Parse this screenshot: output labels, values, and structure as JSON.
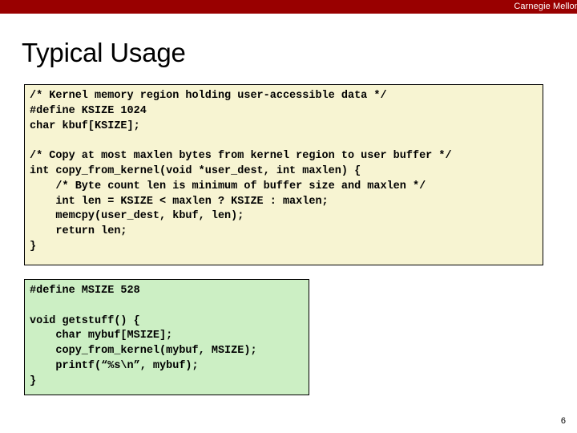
{
  "header": {
    "brand": "Carnegie Mellon",
    "bar_color": "#990000",
    "text_color": "#ffffff"
  },
  "slide": {
    "title": "Typical Usage",
    "page_number": "6"
  },
  "code_blocks": [
    {
      "name": "kernel-code",
      "background_color": "#F7F4D2",
      "border_color": "#000000",
      "lines": [
        "/* Kernel memory region holding user-accessible data */",
        "#define KSIZE 1024",
        "char kbuf[KSIZE];",
        "",
        "/* Copy at most maxlen bytes from kernel region to user buffer */",
        "int copy_from_kernel(void *user_dest, int maxlen) {",
        "    /* Byte count len is minimum of buffer size and maxlen */",
        "    int len = KSIZE < maxlen ? KSIZE : maxlen;",
        "    memcpy(user_dest, kbuf, len);",
        "    return len;",
        "}"
      ]
    },
    {
      "name": "user-code",
      "background_color": "#CCEFC4",
      "border_color": "#000000",
      "lines": [
        "#define MSIZE 528",
        "",
        "void getstuff() {",
        "    char mybuf[MSIZE];",
        "    copy_from_kernel(mybuf, MSIZE);",
        "    printf(“%s\\n”, mybuf);",
        "}"
      ]
    }
  ]
}
